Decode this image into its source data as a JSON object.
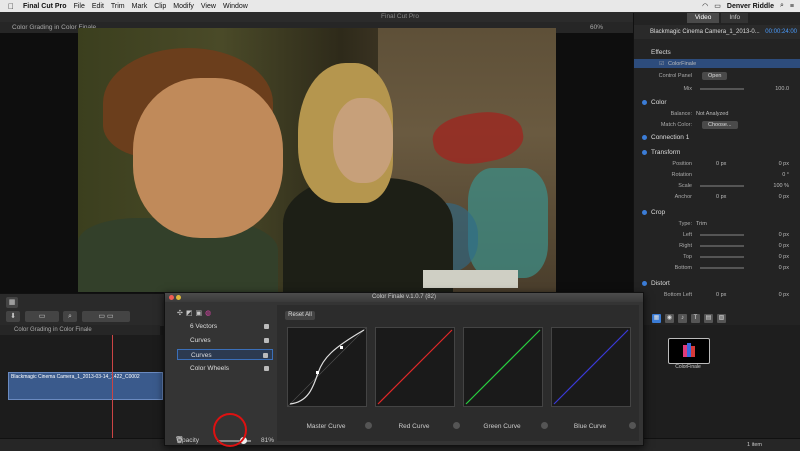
{
  "menubar": {
    "apple": "",
    "app_name": "Final Cut Pro",
    "menus": [
      "File",
      "Edit",
      "Trim",
      "Mark",
      "Clip",
      "Modify",
      "View",
      "Window"
    ],
    "user": "Denver Riddle"
  },
  "window_title": "Final Cut Pro",
  "viewer": {
    "title": "Color Grading in Color Finale",
    "zoom": "60%"
  },
  "inspector": {
    "tabs": [
      "Video",
      "Info"
    ],
    "clip_name": "Blackmagic Cinema Camera_1_2013-0...",
    "timecode": "00:00:24:00",
    "effects_label": "Effects",
    "color_finale": "ColorFinale",
    "control_panel_label": "Control Panel",
    "control_panel_btn": "Open",
    "mix_label": "Mix",
    "mix_value": "100.0",
    "color_label": "Color",
    "balance_label": "Balance:",
    "balance_value": "Not Analyzed",
    "match_color_label": "Match Color:",
    "match_color_btn": "Choose...",
    "connection_label": "Connection 1",
    "transform_label": "Transform",
    "position_label": "Position",
    "position_x": "0 px",
    "position_y": "0 px",
    "rotation_label": "Rotation",
    "rotation_value": "0 °",
    "scale_label": "Scale",
    "scale_value": "100 %",
    "anchor_label": "Anchor",
    "anchor_x": "0 px",
    "anchor_y": "0 px",
    "crop_label": "Crop",
    "crop_type_label": "Type:",
    "crop_type_value": "Trim",
    "left_label": "Left",
    "left_value": "0 px",
    "right_label": "Right",
    "right_value": "0 px",
    "top_label": "Top",
    "top_value": "0 px",
    "bottom_label": "Bottom",
    "bottom_value": "0 px",
    "distort_label": "Distort",
    "bottom_left_label": "Bottom Left",
    "bottom_left_x": "0 px",
    "bottom_left_y": "0 px"
  },
  "timeline": {
    "header": "Color Grading in Color Finale",
    "clip_label": "Blackmagic Cinema Camera_1_2013-03-14_1422_C0002",
    "zoom_label": "1 item"
  },
  "fx_browser": {
    "thumb_label": "ColorFinale"
  },
  "color_finale": {
    "title": "Color Finale v.1.0.7 (82)",
    "layers": [
      {
        "name": "6 Vectors",
        "icon": "vectors-icon"
      },
      {
        "name": "Curves",
        "icon": "curves-icon"
      },
      {
        "name": "Curves",
        "icon": "curves-icon"
      },
      {
        "name": "Color Wheels",
        "icon": "color-wheels-icon"
      }
    ],
    "reset_all": "Reset All",
    "curves": [
      {
        "label": "Master Curve",
        "color": "#e0e0e0"
      },
      {
        "label": "Red Curve",
        "color": "#e02828"
      },
      {
        "label": "Green Curve",
        "color": "#28d040"
      },
      {
        "label": "Blue Curve",
        "color": "#3a3ad8"
      }
    ],
    "opacity_label": "Opacity",
    "opacity_value": "81%"
  }
}
